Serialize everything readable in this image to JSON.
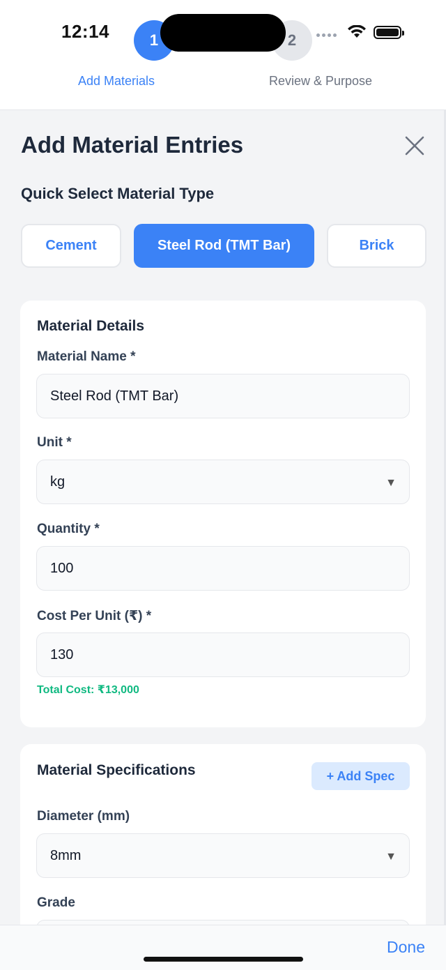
{
  "status_bar": {
    "time": "12:14"
  },
  "stepper": {
    "steps": [
      {
        "number": "1",
        "label": "Add Materials"
      },
      {
        "number": "2",
        "label": "Review & Purpose"
      }
    ]
  },
  "sheet": {
    "title": "Add Material Entries",
    "close_icon": "close-icon"
  },
  "quick_select": {
    "title": "Quick Select Material Type",
    "options": [
      "Cement",
      "Steel Rod (TMT Bar)",
      "Brick"
    ],
    "selected": "Steel Rod (TMT Bar)"
  },
  "details": {
    "title": "Material Details",
    "name_label": "Material Name *",
    "name_value": "Steel Rod (TMT Bar)",
    "unit_label": "Unit *",
    "unit_value": "kg",
    "quantity_label": "Quantity *",
    "quantity_value": "100",
    "cost_label": "Cost Per Unit (₹) *",
    "cost_value": "130",
    "total_cost": "Total Cost: ₹13,000"
  },
  "specs": {
    "title": "Material Specifications",
    "add_button": "+ Add Spec",
    "diameter_label": "Diameter (mm)",
    "diameter_value": "8mm",
    "grade_label": "Grade"
  },
  "bottom": {
    "done": "Done"
  },
  "colors": {
    "accent": "#3b82f6",
    "success": "#10b981"
  }
}
